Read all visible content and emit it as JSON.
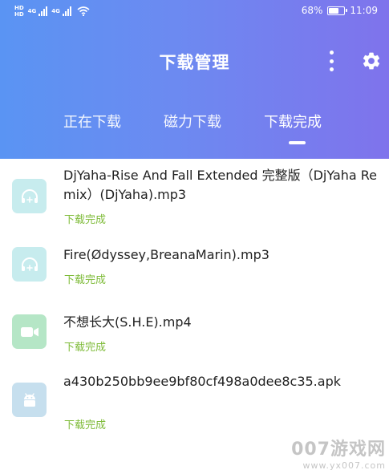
{
  "status_bar": {
    "network_1": "HD",
    "network_2": "HD",
    "net_type_1": "4G",
    "net_type_2": "4G",
    "battery_percent": "68%",
    "battery_level": 0.68,
    "time": "11:09"
  },
  "header": {
    "title": "下载管理",
    "more_icon": "more-vertical-icon",
    "settings_icon": "gear-icon"
  },
  "tabs": [
    {
      "label": "正在下载",
      "active": false
    },
    {
      "label": "磁力下载",
      "active": false
    },
    {
      "label": "下载完成",
      "active": true
    }
  ],
  "downloads": [
    {
      "name": "DjYaha-Rise And Fall Extended 完整版（DjYaha Remix）(DjYaha).mp3",
      "status": "下载完成",
      "icon": "headphones-icon",
      "type": "audio"
    },
    {
      "name": "Fire(Ødyssey,BreanaMarin).mp3",
      "status": "下载完成",
      "icon": "headphones-icon",
      "type": "audio"
    },
    {
      "name": "不想长大(S.H.E).mp4",
      "status": "下载完成",
      "icon": "video-camera-icon",
      "type": "video"
    },
    {
      "name": "a430b250bb9ee9bf80cf498a0dee8c35.apk",
      "status": "下载完成",
      "icon": "android-icon",
      "type": "apk"
    }
  ],
  "watermark": {
    "brand": "007游戏网",
    "url": "www.yx007.com"
  },
  "colors": {
    "header_gradient_start": "#5a94f3",
    "header_gradient_end": "#7f73ec",
    "status_green": "#7ebb38",
    "audio_icon_bg": "#c7ecee",
    "video_icon_bg": "#b5e6c6",
    "apk_icon_bg": "#c6dfee"
  }
}
